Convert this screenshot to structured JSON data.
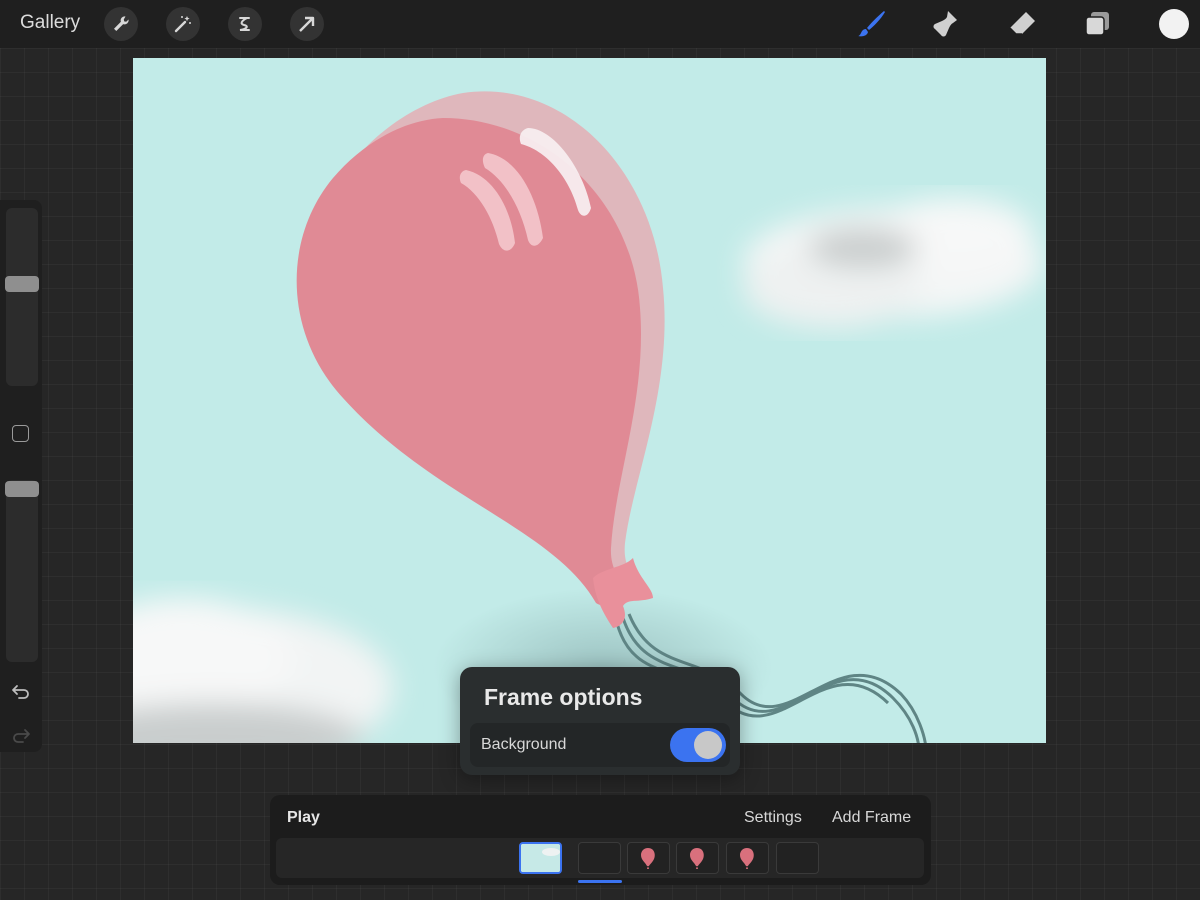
{
  "topbar": {
    "gallery_label": "Gallery",
    "left_tools": [
      "wrench-icon",
      "magic-wand-icon",
      "selection-icon",
      "transform-arrow-icon"
    ],
    "right_tools": [
      "brush-icon",
      "smudge-icon",
      "eraser-icon",
      "layers-icon"
    ],
    "accent_color": "#3b73f0",
    "current_color": "#f2f2f2"
  },
  "popup": {
    "title": "Frame options",
    "background_label": "Background",
    "background_enabled": true
  },
  "timeline": {
    "play_label": "Play",
    "settings_label": "Settings",
    "add_frame_label": "Add Frame",
    "frames": [
      {
        "type": "background",
        "selected": true
      },
      {
        "type": "empty",
        "selected": false
      },
      {
        "type": "balloon",
        "selected": false
      },
      {
        "type": "balloon",
        "selected": false
      },
      {
        "type": "balloon",
        "selected": false
      },
      {
        "type": "empty",
        "selected": false
      }
    ]
  }
}
